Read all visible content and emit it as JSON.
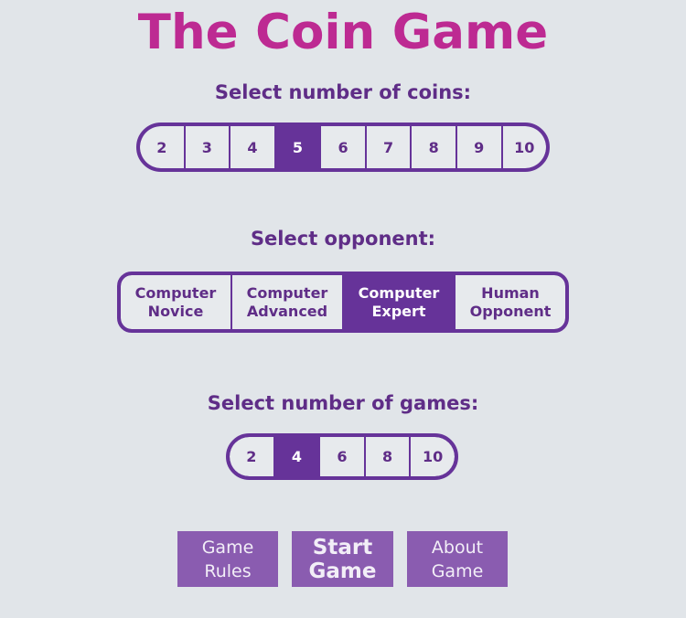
{
  "page": {
    "title": "The Coin Game",
    "background_color": "#e1e5e9",
    "title_color": "#bd2a92",
    "accent_color": "#663399",
    "button_color": "#8a5cb0"
  },
  "coins_section": {
    "label": "Select number of coins:",
    "selected": "5",
    "options": [
      {
        "label": "2",
        "selected": false
      },
      {
        "label": "3",
        "selected": false
      },
      {
        "label": "4",
        "selected": false
      },
      {
        "label": "5",
        "selected": true
      },
      {
        "label": "6",
        "selected": false
      },
      {
        "label": "7",
        "selected": false
      },
      {
        "label": "8",
        "selected": false
      },
      {
        "label": "9",
        "selected": false
      },
      {
        "label": "10",
        "selected": false
      }
    ]
  },
  "opponent_section": {
    "label": "Select opponent:",
    "selected": "Computer Expert",
    "options": [
      {
        "line1": "Computer",
        "line2": "Novice",
        "selected": false
      },
      {
        "line1": "Computer",
        "line2": "Advanced",
        "selected": false
      },
      {
        "line1": "Computer",
        "line2": "Expert",
        "selected": true
      },
      {
        "line1": "Human",
        "line2": "Opponent",
        "selected": false
      }
    ]
  },
  "games_section": {
    "label": "Select number of games:",
    "selected": "4",
    "options": [
      {
        "label": "2",
        "selected": false
      },
      {
        "label": "4",
        "selected": true
      },
      {
        "label": "6",
        "selected": false
      },
      {
        "label": "8",
        "selected": false
      },
      {
        "label": "10",
        "selected": false
      }
    ]
  },
  "actions": {
    "game_rules": {
      "line1": "Game",
      "line2": "Rules"
    },
    "start_game": {
      "line1": "Start",
      "line2": "Game"
    },
    "about_game": {
      "line1": "About",
      "line2": "Game"
    }
  }
}
